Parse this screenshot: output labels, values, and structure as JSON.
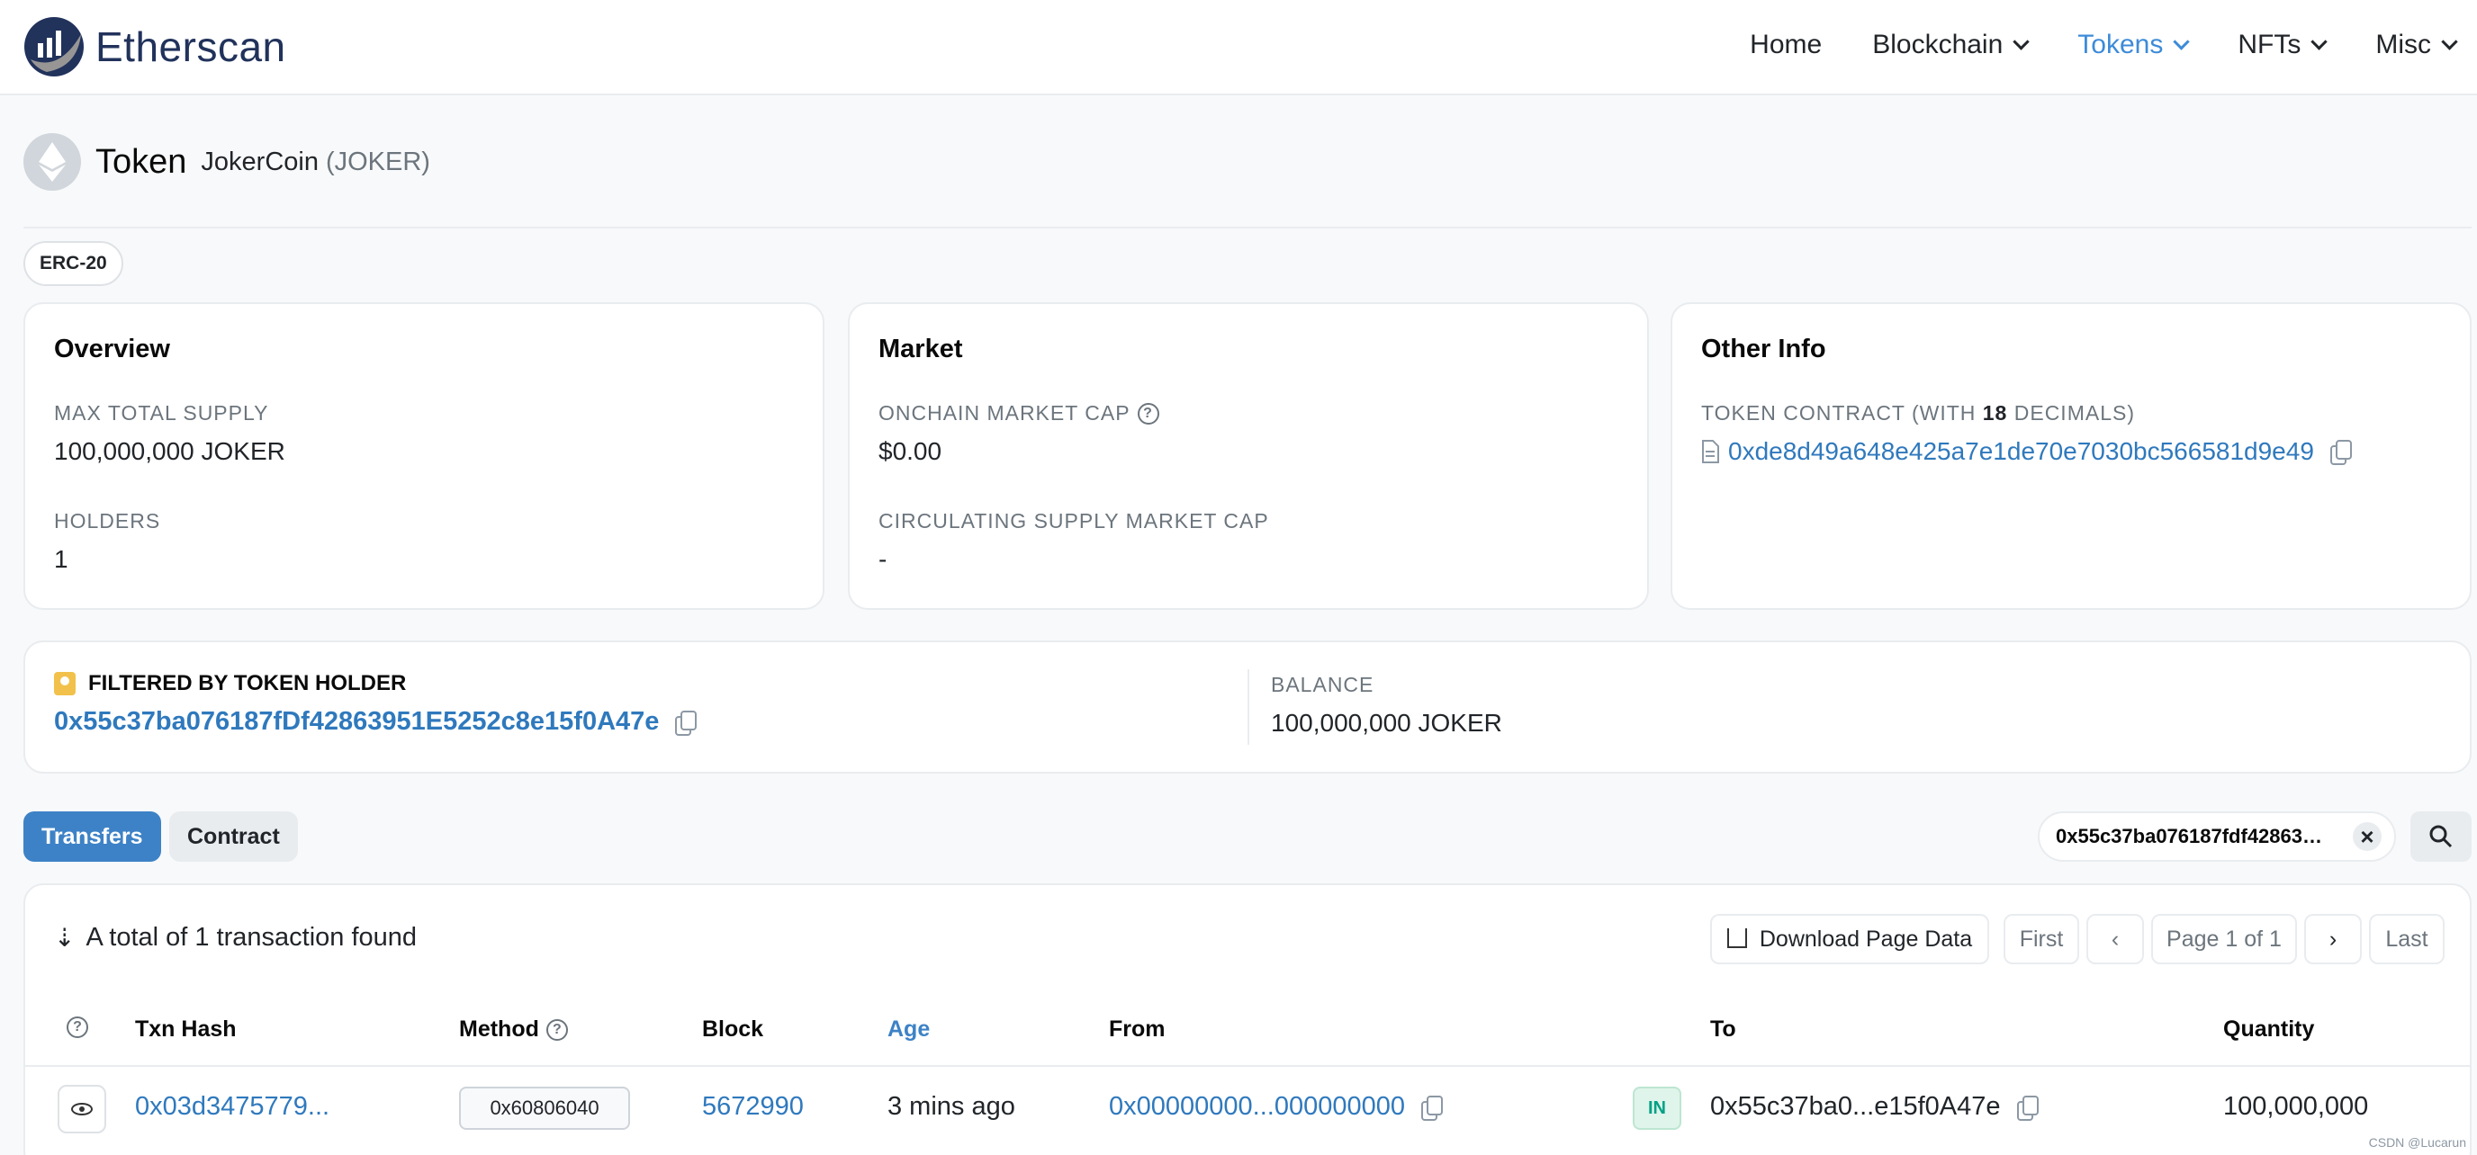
{
  "brand": {
    "name": "Etherscan"
  },
  "nav": {
    "items": [
      {
        "label": "Home",
        "dropdown": false,
        "active": false
      },
      {
        "label": "Blockchain",
        "dropdown": true,
        "active": false
      },
      {
        "label": "Tokens",
        "dropdown": true,
        "active": true
      },
      {
        "label": "NFTs",
        "dropdown": true,
        "active": false
      },
      {
        "label": "Misc",
        "dropdown": true,
        "active": false
      }
    ]
  },
  "token": {
    "title": "Token",
    "name": "JokerCoin",
    "symbol": "(JOKER)",
    "standard": "ERC-20"
  },
  "overview": {
    "title": "Overview",
    "max_supply_label": "MAX TOTAL SUPPLY",
    "max_supply_value": "100,000,000 JOKER",
    "holders_label": "HOLDERS",
    "holders_value": "1"
  },
  "market": {
    "title": "Market",
    "onchain_cap_label": "ONCHAIN MARKET CAP",
    "onchain_cap_value": "$0.00",
    "circ_cap_label": "CIRCULATING SUPPLY MARKET CAP",
    "circ_cap_value": "-"
  },
  "other_info": {
    "title": "Other Info",
    "contract_label_prefix": "TOKEN CONTRACT (WITH ",
    "decimals": "18",
    "contract_label_suffix": " DECIMALS)",
    "contract_address": "0xde8d49a648e425a7e1de70e7030bc566581d9e49"
  },
  "filter": {
    "label": "FILTERED BY TOKEN HOLDER",
    "address": "0x55c37ba076187fDf42863951E5252c8e15f0A47e",
    "balance_label": "BALANCE",
    "balance_value": "100,000,000 JOKER"
  },
  "tabs": [
    {
      "label": "Transfers",
      "active": true
    },
    {
      "label": "Contract",
      "active": false
    }
  ],
  "search_filter": {
    "value": "0x55c37ba076187fdf42863951e5252c8e15f0a47e",
    "display": "0x55c37ba076187fdf4286395..."
  },
  "table": {
    "total_text": "A total of 1 transaction found",
    "download_label": "Download Page Data",
    "pagination": {
      "first": "First",
      "page": "Page 1 of 1",
      "last": "Last"
    },
    "columns": [
      "Txn Hash",
      "Method",
      "Block",
      "Age",
      "From",
      "To",
      "Quantity"
    ],
    "rows": [
      {
        "txn_hash": "0x03d3475779...",
        "method": "0x60806040",
        "block": "5672990",
        "age": "3 mins ago",
        "from": "0x00000000...000000000",
        "direction": "IN",
        "to": "0x55c37ba0...e15f0A47e",
        "quantity": "100,000,000"
      }
    ]
  },
  "watermark": "CSDN @Lucarun",
  "colors": {
    "accent": "#3d82c6",
    "brand": "#21325b",
    "link": "#2f79bd",
    "in_badge": "#00a186"
  }
}
